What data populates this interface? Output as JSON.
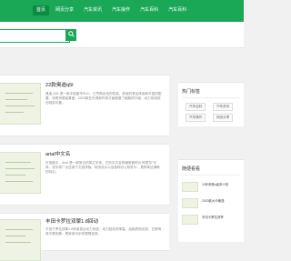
{
  "nav": {
    "items": [
      {
        "label": "首页",
        "active": true
      },
      {
        "label": "网页分享"
      },
      {
        "label": "汽车资讯"
      },
      {
        "label": "汽车操作"
      },
      {
        "label": "汽车百科"
      },
      {
        "label": "汽车百科"
      }
    ]
  },
  "search": {
    "placeholder": "",
    "button_icon": "search-icon"
  },
  "posts": [
    {
      "title": "22款奥迪q5l",
      "excerpt": "奥迪 Q5L 是一款中型豪华SUV，它凭借出色的性能、舒适的乘坐体验和丰富的配置，深受消费者喜爱。2022款在外观和内饰方面都做了细致的升级，动力系统依旧强劲可靠。",
      "author": "",
      "date": "",
      "views": ""
    },
    {
      "title": "arial中文名",
      "excerpt": "在电脑中，Arial 是一款常见的英文字体，它的中文名称通常被称为“阿里尔”字体。该字体广泛应用于文档排版、网页设计以及各种办公软件中，具有简洁清晰的特点。",
      "author": "",
      "date": "",
      "views": ""
    },
    {
      "title": "丰田卡罗拉双擎1.8回动",
      "excerpt": "丰田卡罗拉双擎1.8采用混合动力系统，动力回收效率高，油耗表现优秀，日常驾驶平顺安静，是家用代步的理想选择。",
      "author": "",
      "date": "",
      "views": ""
    }
  ],
  "sidebar": {
    "hot_tags_title": "热门标签",
    "tags": [
      "汽车百科",
      "汽车资讯",
      "汽车操作",
      "网页分享"
    ],
    "recommend_title": "随便看看",
    "recommended": [
      {
        "title": "10年奔驰c级多少钱",
        "date": ""
      },
      {
        "title": "2020款大众朗逸",
        "date": ""
      },
      {
        "title": "丰田卡罗拉双擎",
        "date": ""
      }
    ]
  },
  "colors": {
    "brand": "#1aa856",
    "brand_dark": "#0d8a42",
    "page_bg": "#f1f1f1"
  }
}
